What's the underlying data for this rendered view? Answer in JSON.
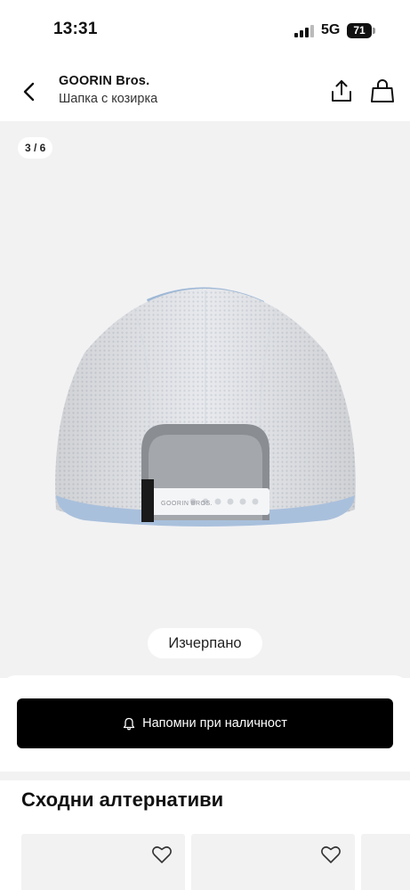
{
  "status_bar": {
    "time": "13:31",
    "network": "5G",
    "battery": "71"
  },
  "header": {
    "brand": "GOORIN Bros.",
    "subtitle": "Шапка с козирка",
    "icons": [
      "chevron-left-icon",
      "share-icon",
      "shopping-bag-icon"
    ]
  },
  "gallery": {
    "counter": "3 / 6",
    "sold_out_label": "Изчерпано",
    "strap_text": "GOORIN BROS."
  },
  "action": {
    "notify_label": "Напомни при наличност",
    "icon": "bell-icon"
  },
  "alternatives": {
    "title": "Сходни алтернативи",
    "card_icon": "heart-icon"
  },
  "colors": {
    "gallery_bg": "#f2f2f3",
    "button_bg": "#000000",
    "cap_mesh": "#e7e9ed",
    "cap_crown": "#9fb8d6"
  }
}
